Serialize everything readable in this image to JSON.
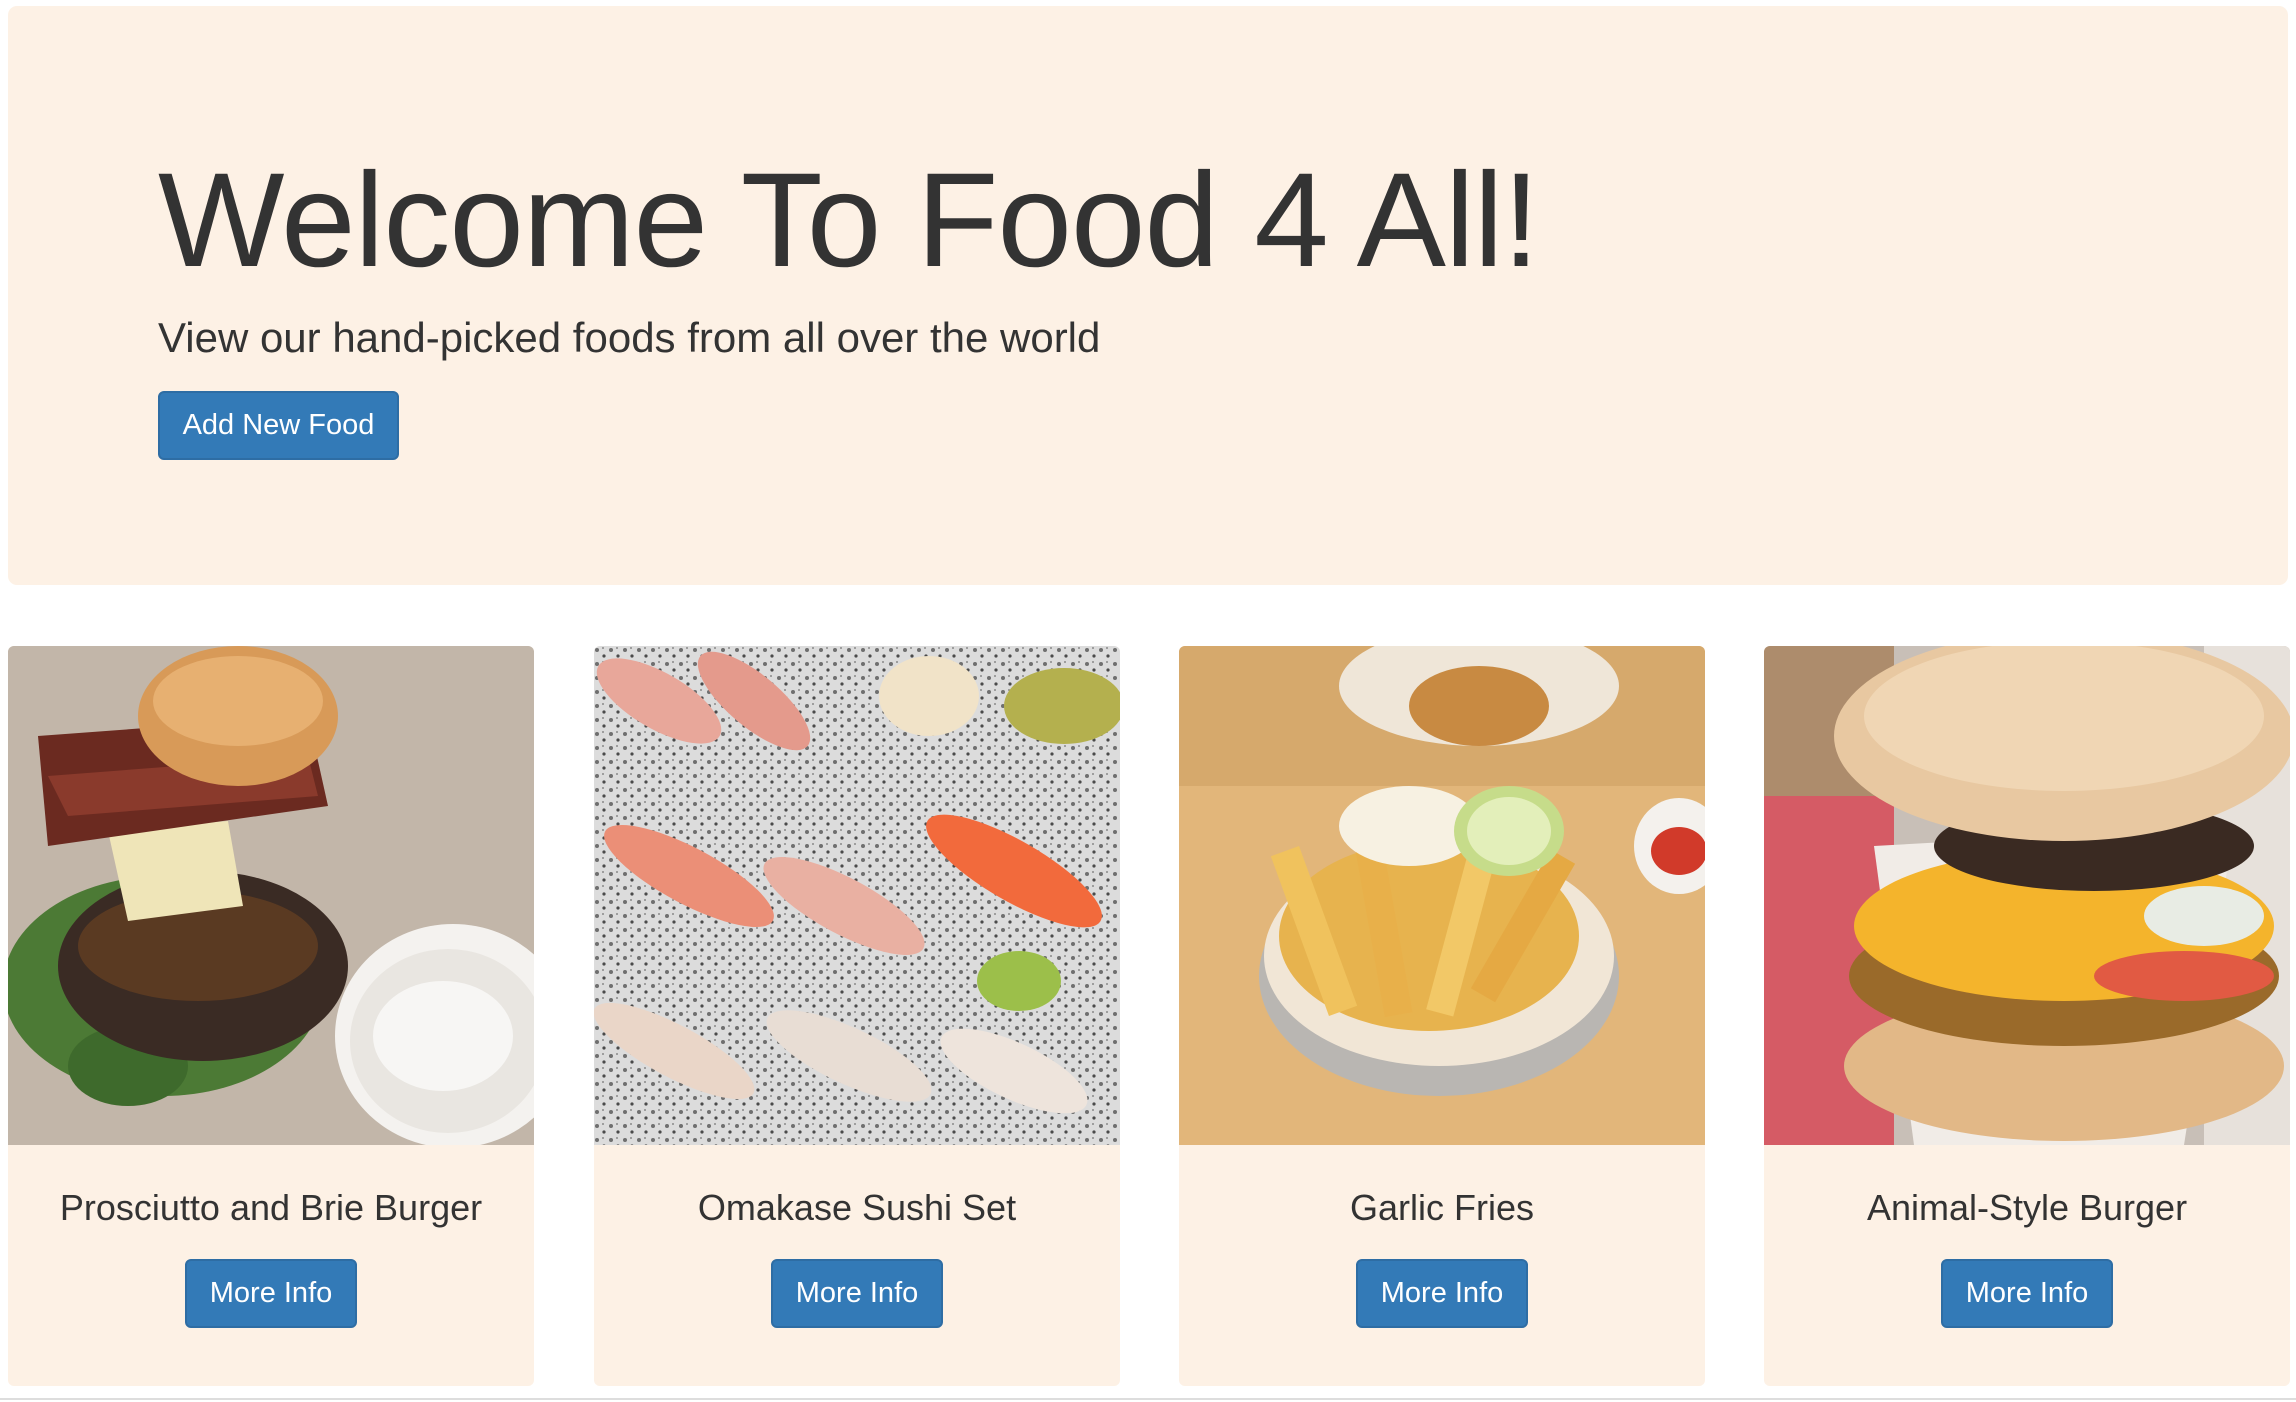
{
  "hero": {
    "title": "Welcome To Food 4 All!",
    "subtitle": "View our hand-picked foods from all over the world",
    "add_button_label": "Add New Food"
  },
  "foods": [
    {
      "name": "Prosciutto and Brie Burger",
      "button_label": "More Info",
      "image": "burger-photo"
    },
    {
      "name": "Omakase Sushi Set",
      "button_label": "More Info",
      "image": "sushi-photo"
    },
    {
      "name": "Garlic Fries",
      "button_label": "More Info",
      "image": "fries-photo"
    },
    {
      "name": "Animal-Style Burger",
      "button_label": "More Info",
      "image": "burger-photo"
    }
  ],
  "colors": {
    "jumbotron_bg": "#fdf1e5",
    "button_bg": "#337ab7",
    "text": "#333333"
  }
}
